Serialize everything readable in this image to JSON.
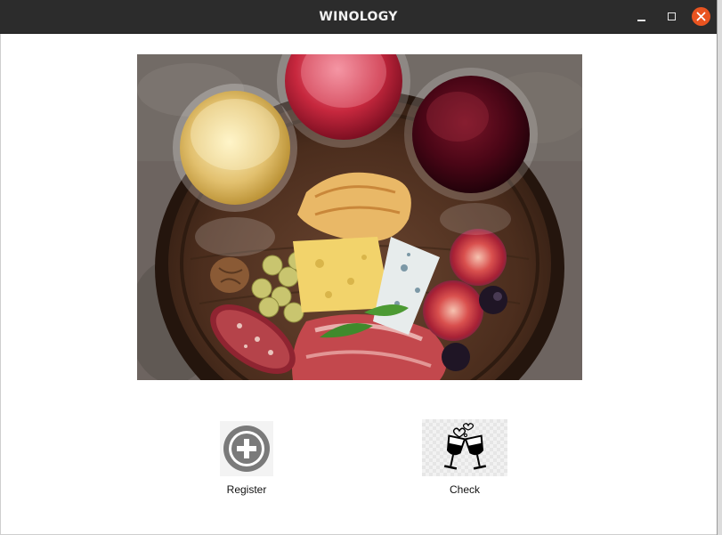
{
  "window": {
    "title": "WINOLOGY",
    "controls": [
      "minimize-icon",
      "maximize-icon",
      "close-icon"
    ],
    "close_color": "#e95420",
    "titlebar_color": "#2c2c2c"
  },
  "hero": {
    "icon": "wine-and-cheese-photo"
  },
  "actions": {
    "register": {
      "label": "Register",
      "icon": "plus-circle-icon"
    },
    "check": {
      "label": "Check",
      "icon": "wine-glasses-cheers-icon"
    }
  }
}
